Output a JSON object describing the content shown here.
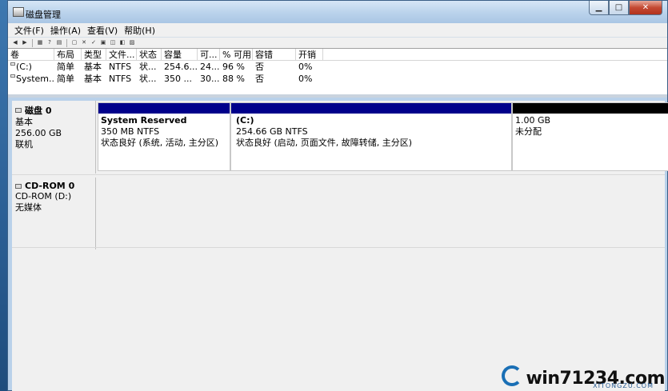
{
  "window": {
    "title": "磁盘管理"
  },
  "controls": {
    "minimize": "▁",
    "maximize": "□",
    "close": "✕"
  },
  "menu": [
    "文件(F)",
    "操作(A)",
    "查看(V)",
    "帮助(H)"
  ],
  "volume_list": {
    "columns": [
      "卷",
      "布局",
      "类型",
      "文件...",
      "状态",
      "容量",
      "可...",
      "% 可用",
      "容错",
      "开销"
    ],
    "rows": [
      [
        "(C:)",
        "简单",
        "基本",
        "NTFS",
        "状...",
        "254.6...",
        "24...",
        "96 %",
        "否",
        "0%"
      ],
      [
        "System...",
        "简单",
        "基本",
        "NTFS",
        "状...",
        "350 ...",
        "30...",
        "88 %",
        "否",
        "0%"
      ]
    ]
  },
  "disks": [
    {
      "name": "磁盘 0",
      "type": "基本",
      "size": "256.00 GB",
      "status": "联机",
      "partitions": [
        {
          "title": "System Reserved",
          "line1": "350 MB NTFS",
          "line2": "状态良好 (系统, 活动, 主分区)"
        },
        {
          "title": "(C:)",
          "line1": "254.66 GB NTFS",
          "line2": "状态良好 (启动, 页面文件, 故障转储, 主分区)"
        },
        {
          "title": "",
          "line1": "1.00 GB",
          "line2": "未分配"
        }
      ]
    },
    {
      "name": "CD-ROM 0",
      "type": "CD-ROM (D:)",
      "size": "",
      "status": "无媒体"
    }
  ],
  "colors": {
    "primary_partition": "#00008b",
    "unallocated": "#000000"
  },
  "watermark": {
    "text": "win71234.com",
    "sub": "XITONGZU.COM"
  }
}
